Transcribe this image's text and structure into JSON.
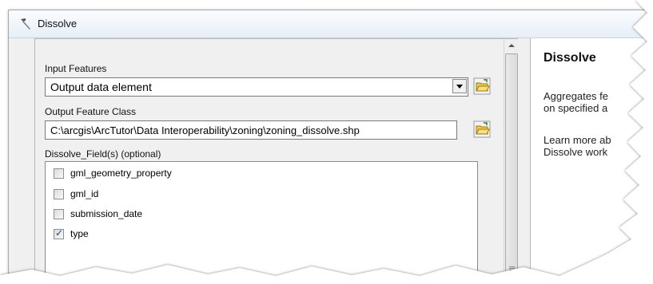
{
  "window": {
    "title": "Dissolve",
    "title_icon": "hammer-icon"
  },
  "form": {
    "input_features_label": "Input Features",
    "input_features_value": "Output data element",
    "output_class_label": "Output Feature Class",
    "output_class_value": "C:\\arcgis\\ArcTutor\\Data Interoperability\\zoning\\zoning_dissolve.shp",
    "dissolve_fields_label": "Dissolve_Field(s) (optional)",
    "fields": [
      {
        "label": "gml_geometry_property",
        "checked": false
      },
      {
        "label": "gml_id",
        "checked": false
      },
      {
        "label": "submission_date",
        "checked": false
      },
      {
        "label": "type",
        "checked": true
      }
    ]
  },
  "help": {
    "title": "Dissolve",
    "line1": "Aggregates fe",
    "line2": "on specified a",
    "line3": "Learn more ab",
    "line4": "Dissolve work"
  },
  "colors": {
    "folder": "#f2c94c",
    "accent": "#1c3f8f"
  }
}
